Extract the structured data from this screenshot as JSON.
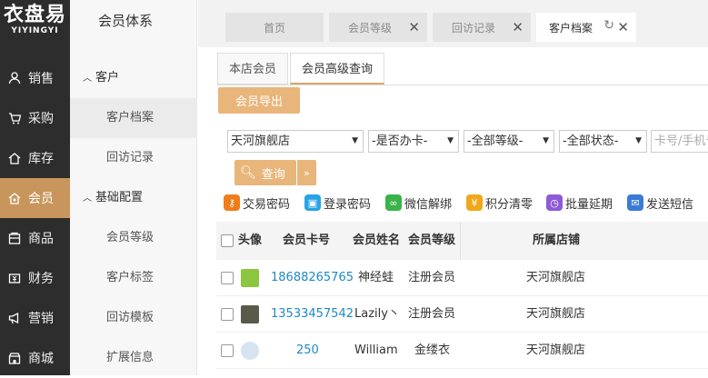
{
  "logo": {
    "cn": "衣盘易",
    "en": "YIYINGYI"
  },
  "main_nav": [
    {
      "label": "销售",
      "icon": "user-icon"
    },
    {
      "label": "采购",
      "icon": "cart-icon"
    },
    {
      "label": "库存",
      "icon": "home-icon"
    },
    {
      "label": "会员",
      "icon": "member-icon"
    },
    {
      "label": "商品",
      "icon": "box-icon"
    },
    {
      "label": "财务",
      "icon": "finance-icon"
    },
    {
      "label": "营销",
      "icon": "megaphone-icon"
    },
    {
      "label": "商城",
      "icon": "shop-icon"
    }
  ],
  "sub_nav": {
    "title": "会员体系",
    "items": [
      {
        "label": "客户"
      },
      {
        "label": "客户档案"
      },
      {
        "label": "回访记录"
      },
      {
        "label": "基础配置"
      },
      {
        "label": "会员等级"
      },
      {
        "label": "客户标签"
      },
      {
        "label": "回访模板"
      },
      {
        "label": "扩展信息"
      }
    ]
  },
  "tabs": [
    {
      "label": "首页"
    },
    {
      "label": "会员等级"
    },
    {
      "label": "回访记录"
    },
    {
      "label": "客户档案"
    }
  ],
  "inner_tabs": [
    {
      "label": "本店会员"
    },
    {
      "label": "会员高级查询"
    }
  ],
  "export_button": "会员导出",
  "filters": {
    "store": "天河旗舰店",
    "card": "-是否办卡-",
    "level": "-全部等级-",
    "status": "-全部状态-",
    "search_placeholder": "卡号/手机号"
  },
  "search_button": "查询",
  "actions": [
    {
      "label": "交易密码",
      "icon": "key-icon",
      "color": "#f07d1a"
    },
    {
      "label": "登录密码",
      "icon": "lock-icon",
      "color": "#29a3e6"
    },
    {
      "label": "微信解绑",
      "icon": "link-icon",
      "color": "#3bb34a"
    },
    {
      "label": "积分清零",
      "icon": "coin-icon",
      "color": "#f0a81a"
    },
    {
      "label": "批量延期",
      "icon": "clock-icon",
      "color": "#8e5ad8"
    },
    {
      "label": "发送短信",
      "icon": "mail-icon",
      "color": "#3a7bd5"
    }
  ],
  "table": {
    "headers": [
      "头像",
      "会员卡号",
      "会员姓名",
      "会员等级",
      "所属店铺"
    ],
    "rows": [
      {
        "card": "18688265765",
        "name": "神经蛙",
        "level": "注册会员",
        "store": "天河旗舰店"
      },
      {
        "card": "13533457542",
        "name": "Lazily丶",
        "level": "注册会员",
        "store": "天河旗舰店"
      },
      {
        "card": "250",
        "name": "William",
        "level": "金缕衣",
        "store": "天河旗舰店"
      }
    ]
  }
}
